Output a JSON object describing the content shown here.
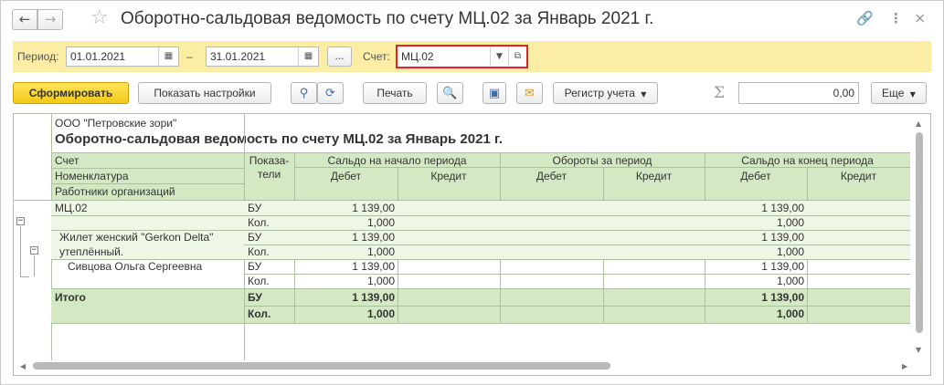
{
  "window": {
    "title": "Оборотно-сальдовая ведомость по счету МЦ.02 за Январь 2021 г.",
    "icons": [
      "back-arrow-icon",
      "forward-arrow-icon",
      "star-icon",
      "link-icon",
      "more-vertical-icon",
      "close-icon"
    ]
  },
  "filter": {
    "period_label": "Период:",
    "date_from": "01.01.2021",
    "dash": "–",
    "date_to": "31.01.2021",
    "choose_period_label": "...",
    "account_label": "Счет:",
    "account_value": "МЦ.02"
  },
  "toolbar": {
    "generate_label": "Сформировать",
    "settings_label": "Показать настройки",
    "print_label": "Печать",
    "register_label": "Регистр учета",
    "sum_value": "0,00",
    "more_label": "Еще"
  },
  "report": {
    "organization": "ООО \"Петровские зори\"",
    "title": "Оборотно-сальдовая ведомость по счету МЦ.02 за Январь 2021 г.",
    "headers": {
      "account": "Счет",
      "nomenclature": "Номенклатура",
      "employees": "Работники организаций",
      "indicators": "Показа-\nтели",
      "opening_balance": "Сальдо на начало периода",
      "turnover": "Обороты за период",
      "closing_balance": "Сальдо на конец периода",
      "debit": "Дебет",
      "credit": "Кредит"
    },
    "rows": [
      {
        "name": "МЦ.02",
        "indicator": "БУ",
        "open_debit": "1 139,00",
        "close_debit": "1 139,00"
      },
      {
        "name": "",
        "indicator": "Кол.",
        "open_debit": "1,000",
        "close_debit": "1,000"
      },
      {
        "name": "Жилет женский \"Gerkon Delta\"",
        "indicator": "БУ",
        "open_debit": "1 139,00",
        "close_debit": "1 139,00"
      },
      {
        "name": "утеплённый.",
        "indicator": "Кол.",
        "open_debit": "1,000",
        "close_debit": "1,000"
      },
      {
        "name": "Сивцова Ольга Сергеевна",
        "indicator": "БУ",
        "open_debit": "1 139,00",
        "close_debit": "1 139,00"
      },
      {
        "name": "",
        "indicator": "Кол.",
        "open_debit": "1,000",
        "close_debit": "1,000"
      }
    ],
    "total": {
      "label": "Итого",
      "rows": [
        {
          "indicator": "БУ",
          "open_debit": "1 139,00",
          "close_debit": "1 139,00"
        },
        {
          "indicator": "Кол.",
          "open_debit": "1,000",
          "close_debit": "1,000"
        }
      ]
    }
  },
  "colors": {
    "filter_bg": "#fbeda3",
    "primary_btn": "#f3c817",
    "header_green": "#d5e8c4",
    "account_highlight": "#e1222a"
  }
}
